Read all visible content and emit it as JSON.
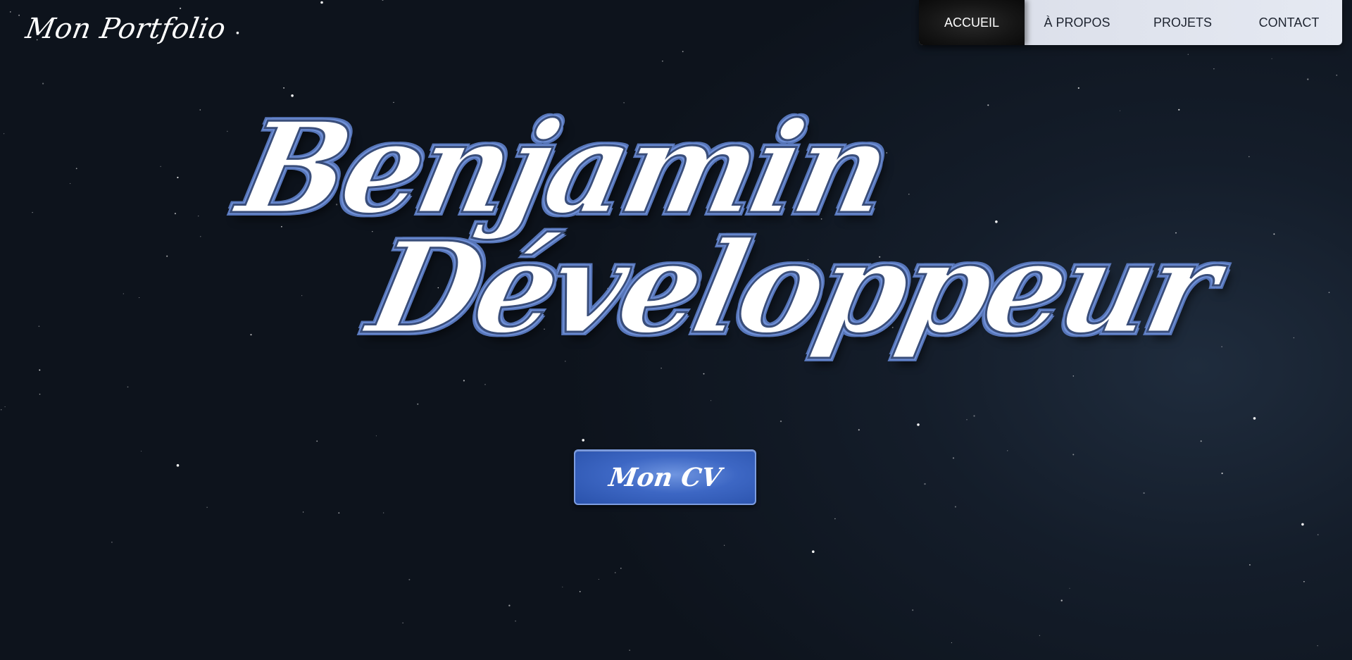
{
  "header": {
    "logo": "Mon Portfolio"
  },
  "nav": {
    "items": [
      {
        "label": "ACCUEIL",
        "active": true
      },
      {
        "label": "À PROPOS",
        "active": false
      },
      {
        "label": "PROJETS",
        "active": false
      },
      {
        "label": "CONTACT",
        "active": false
      }
    ]
  },
  "hero": {
    "line1": "Benjamin",
    "line2": "Développeur",
    "cv_button_label": "Mon CV"
  },
  "colors": {
    "background": "#0d131c",
    "nav_background": "#e2e6ef",
    "nav_active": "#121212",
    "hero_outline": "#6f8fd6",
    "button_accent": "#3d67c4"
  }
}
